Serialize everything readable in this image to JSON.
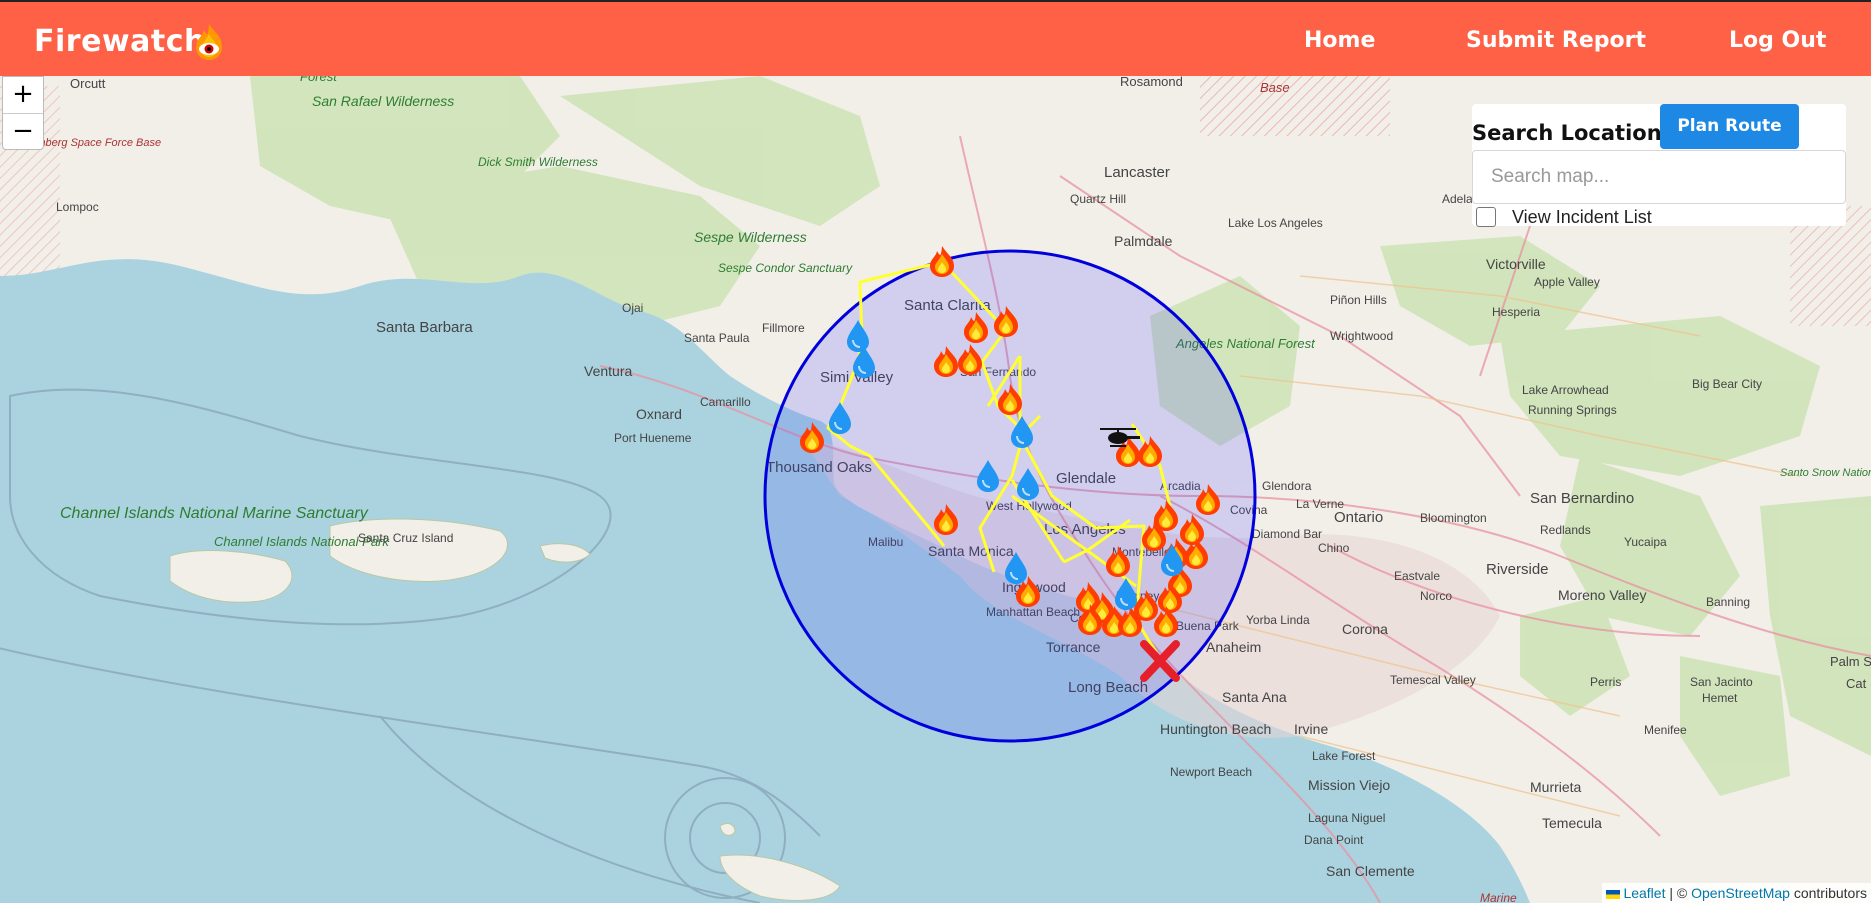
{
  "nav": {
    "brand": "Firewatch",
    "links": [
      "Home",
      "Submit Report",
      "Log Out"
    ]
  },
  "search": {
    "title": "Search Location",
    "plan_route_label": "Plan Route",
    "placeholder": "Search map...",
    "incident_list_label": "View Incident List"
  },
  "zoom": {
    "in": "+",
    "out": "−"
  },
  "attribution": {
    "leaflet": "Leaflet",
    "separator": "| ©",
    "osm": "OpenStreetMap",
    "suffix": "contributors"
  },
  "colors": {
    "navbar": "#ff6147",
    "accent": "#1e88e5",
    "radius": "#0000dd",
    "route": "#ffff33",
    "water": "#aad3df",
    "land": "#f2efe9"
  },
  "map_labels": {
    "places": [
      "Orcutt",
      "Forest",
      "Rosamond",
      "Base",
      "San Rafael Wilderness",
      "Vandenberg Space Force Base",
      "Dick Smith Wilderness",
      "Lancaster",
      "Quartz Hill",
      "Lake Los Angeles",
      "Adelanto",
      "Victorville",
      "Apple Valley",
      "Lompoc",
      "Sespe Wilderness",
      "Sespe Condor Sanctuary",
      "Palmdale",
      "Santa Barbara",
      "Ojai",
      "Fillmore",
      "Santa Clarita",
      "Piñon Hills",
      "Hesperia",
      "Santa Paula",
      "Wrightwood",
      "Ventura",
      "Angeles National Forest",
      "Lake Arrowhead",
      "Big Bear City",
      "Oxnard",
      "Camarillo",
      "Simi Valley",
      "San Fernando",
      "Running Springs",
      "Port Hueneme",
      "Thousand Oaks",
      "Glendale",
      "Arcadia",
      "Glendora",
      "Channel Islands National Marine Sanctuary",
      "Channel Islands National Park",
      "Santa Cruz Island",
      "West Hollywood",
      "Covina",
      "La Verne",
      "Ontario",
      "Bloomington",
      "San Bernardino",
      "Los Angeles",
      "Diamond Bar",
      "Chino",
      "Redlands",
      "Yucaipa",
      "Malibu",
      "Santa Monica",
      "Montebello",
      "Riverside",
      "Inglewood",
      "Eastvale",
      "Norco",
      "Moreno Valley",
      "Banning",
      "Downey",
      "Manhattan Beach",
      "Compton",
      "Buena Park",
      "Yorba Linda",
      "Corona",
      "Torrance",
      "Anaheim",
      "Perris",
      "San Jacinto",
      "Hemet",
      "Long Beach",
      "Temescal Valley",
      "Santa Ana",
      "Menifee",
      "Huntington Beach",
      "Irvine",
      "Lake Forest",
      "Newport Beach",
      "Mission Viejo",
      "Murrieta",
      "Laguna Niguel",
      "Temecula",
      "Dana Point",
      "San Clemente",
      "Marine",
      "Santo Snow National Monument",
      "Palm Springs",
      "Cat"
    ]
  }
}
